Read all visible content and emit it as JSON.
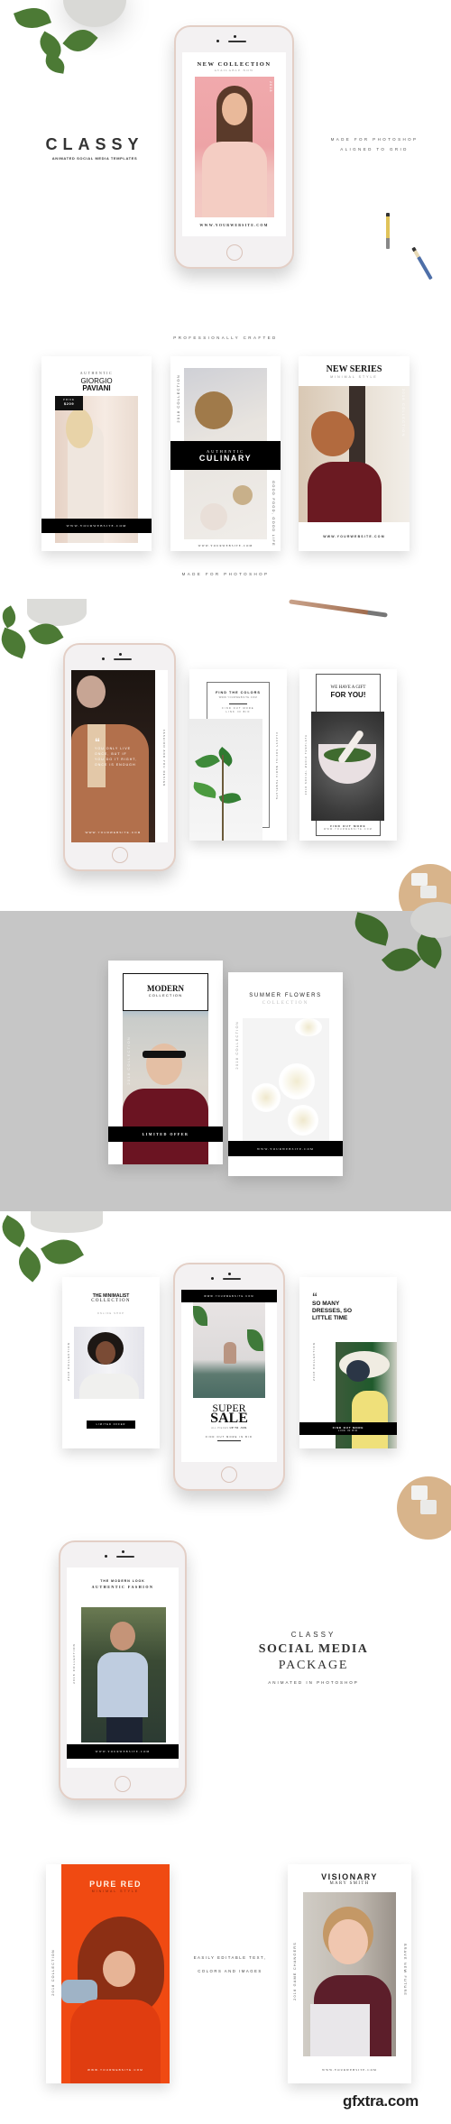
{
  "hero": {
    "brand": "CLASSY",
    "tagline": "ANIMATED SOCIAL MEDIA TEMPLATES",
    "features": [
      "MADE FOR PHOTOSHOP",
      "ALIGNED TO GRID"
    ],
    "phone_screen": {
      "title": "NEW COLLECTION",
      "subtitle": "AVAILABLE NOW",
      "side_text": "2018",
      "url": "WWW.YOURWEBSITE.COM"
    }
  },
  "section2": {
    "top_caption": "PROFESSIONALLY CRAFTED",
    "bottom_caption": "MADE FOR PHOTOSHOP",
    "cards": [
      {
        "kicker": "AUTHENTIC",
        "title_line1": "GIORGIO",
        "title_line2": "PAVIANI",
        "price_label": "PRICE",
        "price": "$209",
        "url": "WWW.YOURWEBSITE.COM"
      },
      {
        "side_left": "2018 COLLECTION",
        "kicker": "AUTHENTIC",
        "title": "CULINARY",
        "side_right": "GOOD FOOD, GOOD LIFE",
        "url": "WWW.YOURWEBSITE.COM"
      },
      {
        "title": "NEW SERIES",
        "subtitle": "MINIMAL STYLE",
        "side_text": "2018 COLLECTION",
        "url": "WWW.YOURWEBSITE.COM"
      }
    ]
  },
  "section3": {
    "phone_screen": {
      "quote_mark": "“",
      "quote": [
        "YOU ONLY LIVE",
        "ONCE, BUT IF",
        "YOU DO IT RIGHT,",
        "ONCE IS ENOUGH"
      ],
      "url": "WWW.YOURWEBSITE.COM",
      "side_text": "FASHION AND YOU DESIGN"
    },
    "cards": [
      {
        "title": "FIND THE COLORS",
        "url": "WWW.YOURWEBSITE.COM",
        "cta_line1": "FIND OUT MORE",
        "cta_line2": "LINK IN BIO",
        "side_text": "CLASSY SOCIAL MEDIA TEMPLATE"
      },
      {
        "title_line1": "WE HAVE A GIFT",
        "title_line2": "FOR YOU!",
        "cta": "FIND OUT MORE",
        "url": "WWW.YOURWEBSITE.COM",
        "side_text": "2018 SOCIAL MEDIA TEMPLATE"
      }
    ]
  },
  "section4": {
    "bg_color": "#c6c6c6",
    "cards": [
      {
        "title": "MODERN",
        "subtitle": "COLLECTION",
        "side_text": "2018 COLLECTION",
        "banner": "LIMITED OFFER"
      },
      {
        "title": "SUMMER FLOWERS",
        "subtitle": "COLLECTION",
        "side_text": "2018 COLLECTION",
        "url": "WWW.YOURWEBSITE.COM"
      }
    ]
  },
  "section5": {
    "cards": [
      {
        "title_line1": "THE MINIMALIST",
        "title_line2": "COLLECTION",
        "subtitle": "ONLINE SHOP",
        "side_text": "2018 COLLECTION",
        "button": "LIMITED OFFER"
      },
      {
        "quote_mark": "“",
        "quote": [
          "SO MANY",
          "DRESSES, SO",
          "LITTLE TIME"
        ],
        "side_text": "2018 COLLECTION",
        "cta_line1": "FIND OUT MORE",
        "cta_line2": "LINK IN BIO"
      }
    ],
    "phone_screen": {
      "url": "WWW.YOURWEBSITE.COM",
      "title_line1": "SUPER",
      "title_line2": "SALE",
      "subtitle_prefix": "ALL PIECES",
      "subtitle_highlight": "UP TO -50%",
      "cta": "FIND OUT MORE IN BIO"
    }
  },
  "section6": {
    "phone_screen": {
      "kicker": "THE MODERN LOOK",
      "title": "AUTHENTIC FASHION",
      "side_text": "2018 COLLECTION",
      "url": "WWW.YOURWEBSITE.COM"
    },
    "headline": {
      "kicker": "CLASSY",
      "line1": "SOCIAL MEDIA",
      "line2": "PACKAGE",
      "sub": "ANIMATED IN PHOTOSHOP"
    }
  },
  "section7": {
    "center_text": [
      "EASILY EDITABLE TEXT,",
      "COLORS AND IMAGES"
    ],
    "cards": [
      {
        "title": "PURE RED",
        "subtitle": "MINIMAL STYLE",
        "side_text": "2018 COLLECTION",
        "url": "WWW.YOURWEBSITE.COM",
        "accent": "#f04a12"
      },
      {
        "title": "VISIONARY",
        "subtitle": "MARY SMITH",
        "side_left": "2018 GAME CHANGERS",
        "side_right": "BRAVE NEW FUTURE",
        "url": "WWW.YOURWEBSITE.COM"
      }
    ]
  },
  "watermark": "gfxtra.com"
}
